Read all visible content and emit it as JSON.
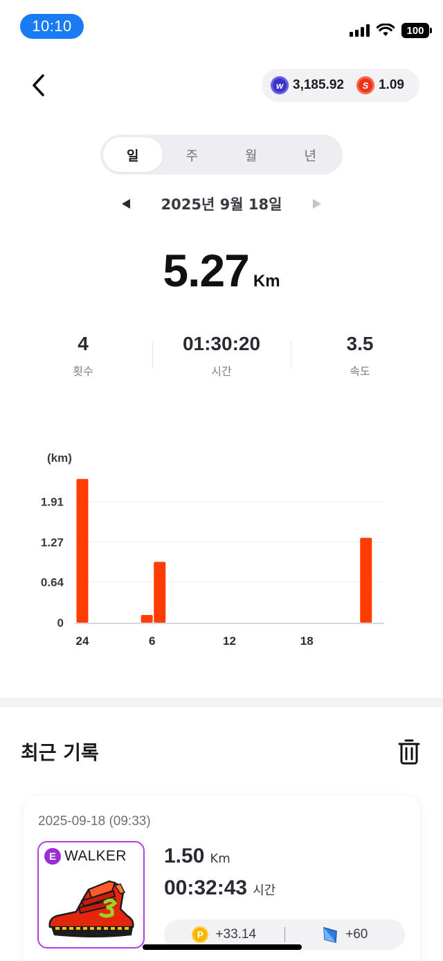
{
  "status_bar": {
    "time": "10:10",
    "battery": "100"
  },
  "header": {
    "balances": [
      {
        "icon": "walker-token-icon",
        "value": "3,185.92"
      },
      {
        "icon": "s-token-icon",
        "value": "1.09"
      }
    ]
  },
  "period_tabs": [
    {
      "label": "일",
      "active": true
    },
    {
      "label": "주",
      "active": false
    },
    {
      "label": "월",
      "active": false
    },
    {
      "label": "년",
      "active": false
    }
  ],
  "date_nav": {
    "label": "2025년 9월 18일"
  },
  "summary": {
    "distance": "5.27",
    "distance_unit": "Km",
    "stats": [
      {
        "value": "4",
        "label": "횟수"
      },
      {
        "value": "01:30:20",
        "label": "시간"
      },
      {
        "value": "3.5",
        "label": "속도"
      }
    ]
  },
  "chart_data": {
    "type": "bar",
    "ylabel": "(km)",
    "yticks": [
      "0",
      "0.64",
      "1.27",
      "1.91"
    ],
    "xticks": [
      "24",
      "6",
      "12",
      "18"
    ],
    "ylim": [
      0,
      2.3
    ],
    "bar_color": "#ff3d00",
    "bars": [
      {
        "hour": 0,
        "value": 2.27
      },
      {
        "hour": 5,
        "value": 0.12
      },
      {
        "hour": 6,
        "value": 0.96
      },
      {
        "hour": 22,
        "value": 1.34
      }
    ]
  },
  "recent": {
    "title": "최근 기록",
    "records": [
      {
        "date": "2025-09-18 (09:33)",
        "grade": "E",
        "shoe_name": "WALKER",
        "distance": "1.50",
        "distance_unit": "Km",
        "duration": "00:32:43",
        "duration_unit": "시간",
        "points": "+33.14",
        "energy": "+60"
      }
    ]
  },
  "colors": {
    "accent": "#1a7cf5",
    "bar": "#ff3d00",
    "grade": "#b03ee0"
  }
}
